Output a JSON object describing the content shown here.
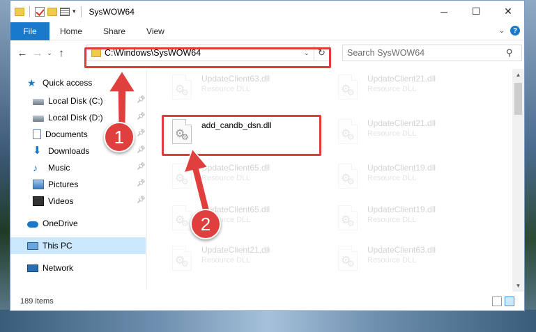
{
  "window": {
    "title": "SysWOW64",
    "controls": {
      "minimize": "─",
      "maximize": "☐",
      "close": "✕"
    }
  },
  "ribbon": {
    "file": "File",
    "tabs": [
      "Home",
      "Share",
      "View"
    ]
  },
  "address": {
    "path": "C:\\Windows\\SysWOW64",
    "refresh_glyph": "↻"
  },
  "search": {
    "placeholder": "Search SysWOW64",
    "icon_glyph": "⚲"
  },
  "nav": {
    "back": "←",
    "forward": "→",
    "recent": "⌄",
    "up": "↑"
  },
  "sidebar": {
    "items": [
      {
        "label": "Quick access",
        "icon": "star-icon"
      },
      {
        "label": "Local Disk (C:)",
        "icon": "drive-icon",
        "pinned": true
      },
      {
        "label": "Local Disk (D:)",
        "icon": "drive-icon",
        "pinned": true
      },
      {
        "label": "Documents",
        "icon": "documents-icon",
        "pinned": true
      },
      {
        "label": "Downloads",
        "icon": "download-icon",
        "pinned": true
      },
      {
        "label": "Music",
        "icon": "music-icon",
        "pinned": true
      },
      {
        "label": "Pictures",
        "icon": "pictures-icon",
        "pinned": true
      },
      {
        "label": "Videos",
        "icon": "videos-icon",
        "pinned": true
      },
      {
        "label": "OneDrive",
        "icon": "cloud-icon"
      },
      {
        "label": "This PC",
        "icon": "pc-icon",
        "selected": true
      },
      {
        "label": "Network",
        "icon": "network-icon"
      }
    ]
  },
  "files": {
    "col1": [
      {
        "name": "UpdateClient63.dll",
        "desc": "Resource DLL"
      },
      {
        "name": "add_candb_dsn.dll",
        "desc": ""
      },
      {
        "name": "UpdateClient65.dll",
        "desc": "Resource DLL"
      },
      {
        "name": "UpdateClient65.dll",
        "desc": "Resource DLL"
      },
      {
        "name": "UpdateClient21.dll",
        "desc": "Resource DLL"
      }
    ],
    "col2": [
      {
        "name": "UpdateClient21.dll",
        "desc": "Resource DLL"
      },
      {
        "name": "UpdateClient21.dll",
        "desc": "Resource DLL"
      },
      {
        "name": "UpdateClient19.dll",
        "desc": "Resource DLL"
      },
      {
        "name": "UpdateClient19.dll",
        "desc": "Resource DLL"
      },
      {
        "name": "UpdateClient63.dll",
        "desc": "Resource DLL"
      }
    ]
  },
  "status": {
    "item_count": "189 items"
  },
  "annotations": {
    "badge1": "1",
    "badge2": "2",
    "color": "#e03b3b"
  }
}
